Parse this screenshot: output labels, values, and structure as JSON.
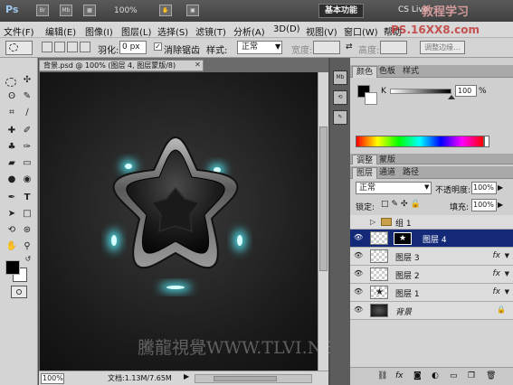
{
  "app": {
    "logo": "Ps",
    "zoom_display": "100%",
    "workspace_button": "基本功能",
    "cs_live": "CS Live",
    "watermark_top": "教程学习"
  },
  "menu": {
    "items": [
      "文件(F)",
      "编辑(E)",
      "图像(I)",
      "图层(L)",
      "选择(S)",
      "滤镜(T)",
      "分析(A)",
      "3D(D)",
      "视图(V)",
      "窗口(W)",
      "帮助"
    ],
    "watermark_url": "PS.16XX8.com"
  },
  "options": {
    "feather_label": "羽化:",
    "feather_value": "0 px",
    "antialias_label": "消除锯齿",
    "style_label": "样式:",
    "style_value": "正常",
    "width_label": "宽度:",
    "height_label": "高度:",
    "refine_edge": "调整边缘..."
  },
  "document": {
    "tab_title": "背景.psd @ 100% (图层 4, 图层蒙版/8)",
    "zoom": "100%",
    "doc_size": "文档:1.13M/7.65M",
    "watermark": "騰龍視覺WWW.TLVI.NET"
  },
  "color_panel": {
    "tabs": [
      "颜色",
      "色板",
      "样式"
    ],
    "channel_label": "K",
    "channel_value": "100",
    "percent": "%"
  },
  "adjust_panel": {
    "tabs": [
      "调整",
      "蒙版"
    ]
  },
  "layers_panel": {
    "tabs": [
      "图层",
      "通道",
      "路径"
    ],
    "blend_mode": "正常",
    "opacity_label": "不透明度:",
    "opacity_value": "100%",
    "lock_label": "锁定:",
    "fill_label": "填充:",
    "fill_value": "100%",
    "layers": [
      {
        "name": "组 1",
        "type": "group",
        "fx": ""
      },
      {
        "name": "图层 4",
        "type": "layer",
        "fx": "",
        "selected": true
      },
      {
        "name": "图层 3",
        "type": "layer",
        "fx": "fx"
      },
      {
        "name": "图层 2",
        "type": "layer",
        "fx": "fx"
      },
      {
        "name": "图层 1",
        "type": "layer",
        "fx": "fx"
      },
      {
        "name": "背景",
        "type": "background",
        "fx": ""
      }
    ]
  },
  "colors": {
    "foreground": "#000000",
    "background": "#ffffff",
    "selection": "#142a78",
    "glow": "#4fe6f2"
  }
}
